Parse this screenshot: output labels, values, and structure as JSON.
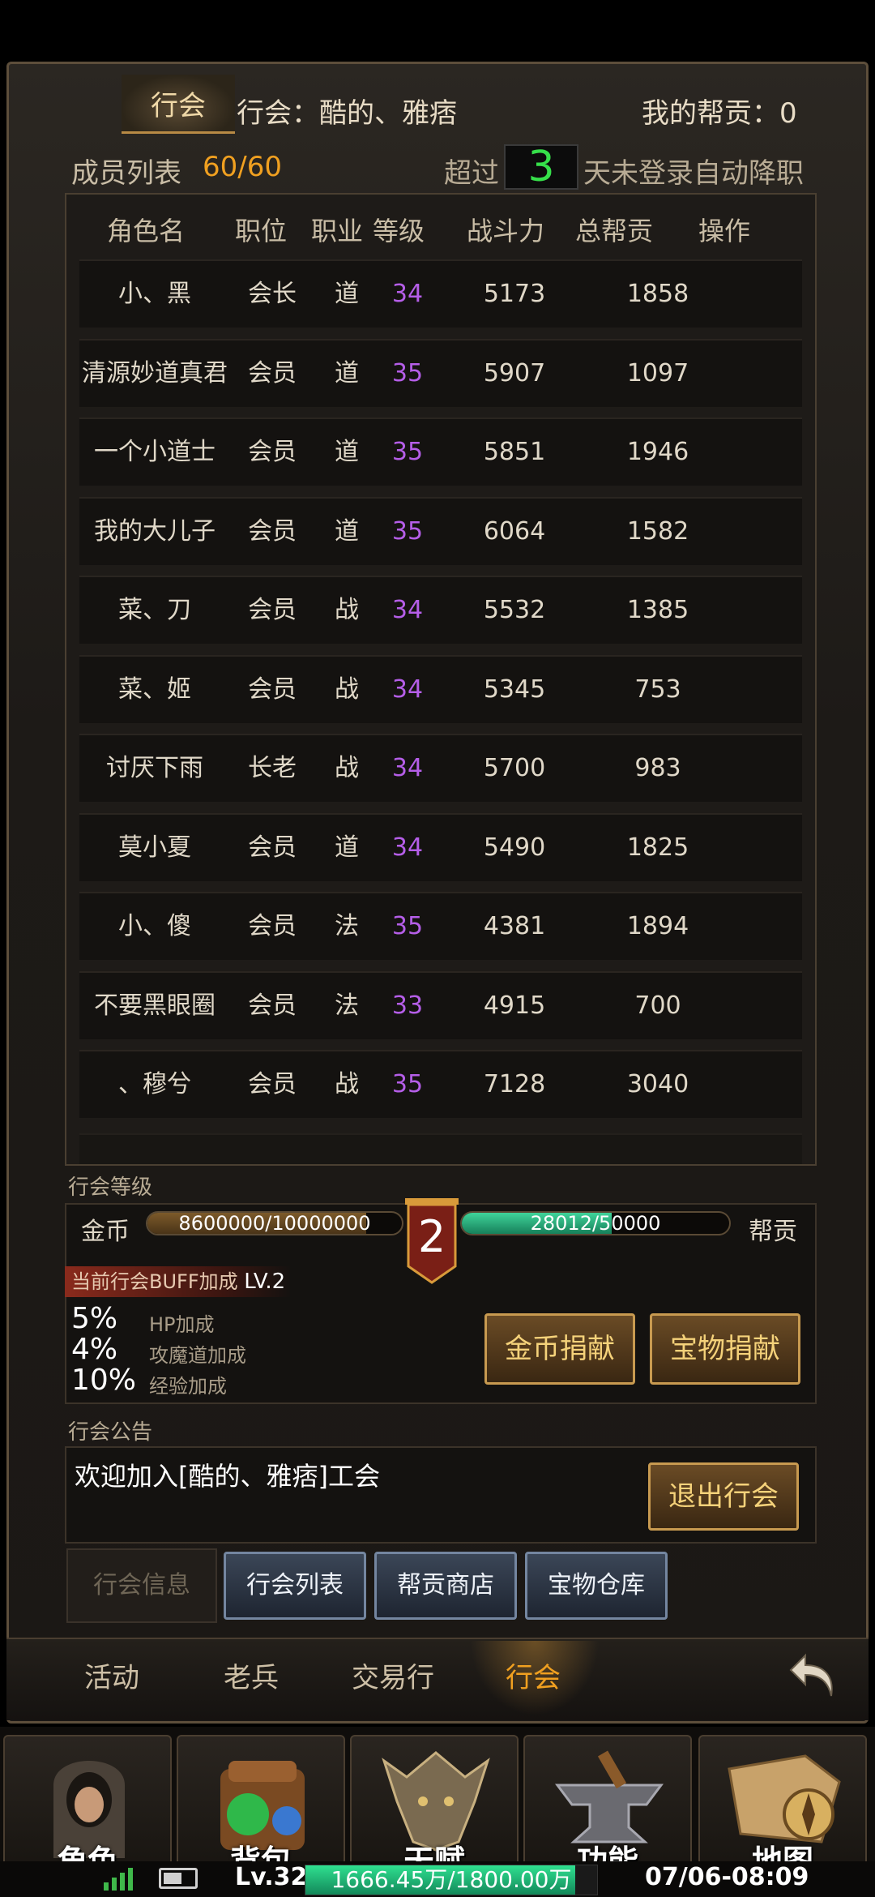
{
  "header": {
    "tab_label": "行会",
    "guild_name": "行会：酷的、雅痞",
    "my_contribution": "我的帮贡：0"
  },
  "member_bar": {
    "label": "成员列表",
    "count": "60/60",
    "demote_prefix": "超过",
    "demote_days": "3",
    "demote_suffix": "天未登录自动降职"
  },
  "table": {
    "columns": [
      "角色名",
      "职位",
      "职业",
      "等级",
      "战斗力",
      "总帮贡",
      "操作"
    ],
    "rows": [
      [
        "小、黑",
        "会长",
        "道",
        "34",
        "5173",
        "1858"
      ],
      [
        "清源妙道真君",
        "会员",
        "道",
        "35",
        "5907",
        "1097"
      ],
      [
        "一个小道士",
        "会员",
        "道",
        "35",
        "5851",
        "1946"
      ],
      [
        "我的大儿子",
        "会员",
        "道",
        "35",
        "6064",
        "1582"
      ],
      [
        "菜、刀",
        "会员",
        "战",
        "34",
        "5532",
        "1385"
      ],
      [
        "菜、姬",
        "会员",
        "战",
        "34",
        "5345",
        "753"
      ],
      [
        "讨厌下雨",
        "长老",
        "战",
        "34",
        "5700",
        "983"
      ],
      [
        "莫小夏",
        "会员",
        "道",
        "34",
        "5490",
        "1825"
      ],
      [
        "小、傻",
        "会员",
        "法",
        "35",
        "4381",
        "1894"
      ],
      [
        "不要黑眼圈",
        "会员",
        "法",
        "33",
        "4915",
        "700"
      ],
      [
        "、穆兮",
        "会员",
        "战",
        "35",
        "7128",
        "3040"
      ]
    ]
  },
  "guild_level": {
    "section_title": "行会等级",
    "gold_label": "金币",
    "gold_progress_text": "8600000/10000000",
    "gold_progress": 0.86,
    "level": "2",
    "contrib_progress_text": "28012/50000",
    "contrib_progress": 0.56,
    "contrib_label": "帮贡",
    "buff_title": "当前行会BUFF加成",
    "buff_level": "LV.2",
    "buffs": [
      {
        "value": "5%",
        "name": "HP加成"
      },
      {
        "value": "4%",
        "name": "攻魔道加成"
      },
      {
        "value": "10%",
        "name": "经验加成"
      }
    ],
    "donate_gold_button": "金币捐献",
    "donate_treasure_button": "宝物捐献"
  },
  "notice": {
    "section_title": "行会公告",
    "text": "欢迎加入[酷的、雅痞]工会",
    "quit_button": "退出行会"
  },
  "sub_tabs": [
    "行会信息",
    "行会列表",
    "帮贡商店",
    "宝物仓库"
  ],
  "nav_tabs": [
    "活动",
    "老兵",
    "交易行",
    "行会"
  ],
  "bottom_icons": [
    {
      "label": "角色",
      "icon": "hooded-hero-icon"
    },
    {
      "label": "背包",
      "icon": "backpack-potion-icon"
    },
    {
      "label": "天赋",
      "icon": "dragon-head-icon"
    },
    {
      "label": "功能",
      "icon": "anvil-icon"
    },
    {
      "label": "地图",
      "icon": "map-compass-icon"
    }
  ],
  "status_bar": {
    "level": "Lv.32",
    "exp_text": "1666.45万/1800.00万",
    "exp_progress": 0.926,
    "datetime": "07/06-08:09"
  },
  "colors": {
    "accent_orange": "#f0a020",
    "level_purple": "#b55ee8",
    "day_green": "#36e04a",
    "exp_green": "#1fc07a"
  }
}
